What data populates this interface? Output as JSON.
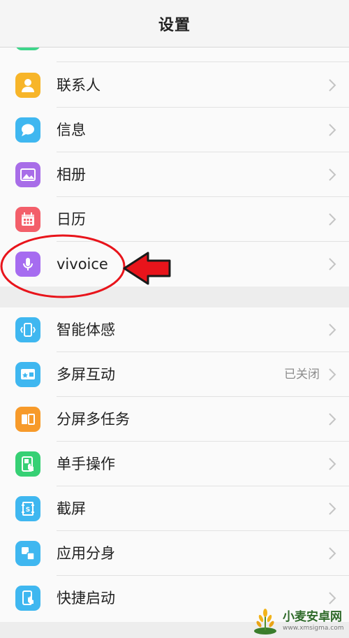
{
  "header": {
    "title": "设置"
  },
  "group1": {
    "items": [
      {
        "label": "联系人",
        "icon": "contacts-icon",
        "color": "#f7b529"
      },
      {
        "label": "信息",
        "icon": "message-icon",
        "color": "#3fb7f0"
      },
      {
        "label": "相册",
        "icon": "gallery-icon",
        "color": "#a86de8"
      },
      {
        "label": "日历",
        "icon": "calendar-icon",
        "color": "#f35f6a"
      },
      {
        "label": "vivoice",
        "icon": "microphone-icon",
        "color": "#a66cf0"
      }
    ]
  },
  "group2": {
    "items": [
      {
        "label": "智能体感",
        "icon": "smart-motion-icon",
        "color": "#3fb7f0",
        "value": ""
      },
      {
        "label": "多屏互动",
        "icon": "multi-screen-icon",
        "color": "#3fb7f0",
        "value": "已关闭"
      },
      {
        "label": "分屏多任务",
        "icon": "split-screen-icon",
        "color": "#f79a2a",
        "value": ""
      },
      {
        "label": "单手操作",
        "icon": "one-hand-icon",
        "color": "#36d074",
        "value": ""
      },
      {
        "label": "截屏",
        "icon": "screenshot-icon",
        "color": "#3fb7f0",
        "value": ""
      },
      {
        "label": "应用分身",
        "icon": "app-clone-icon",
        "color": "#3fb7f0",
        "value": ""
      },
      {
        "label": "快捷启动",
        "icon": "quick-launch-icon",
        "color": "#3fb7f0",
        "value": ""
      }
    ]
  },
  "colors": {
    "annotation_red": "#e8141b",
    "chevron": "#c4c4c4"
  },
  "watermark": {
    "name": "小麦安卓网",
    "url": "www.xmsigma.com"
  }
}
